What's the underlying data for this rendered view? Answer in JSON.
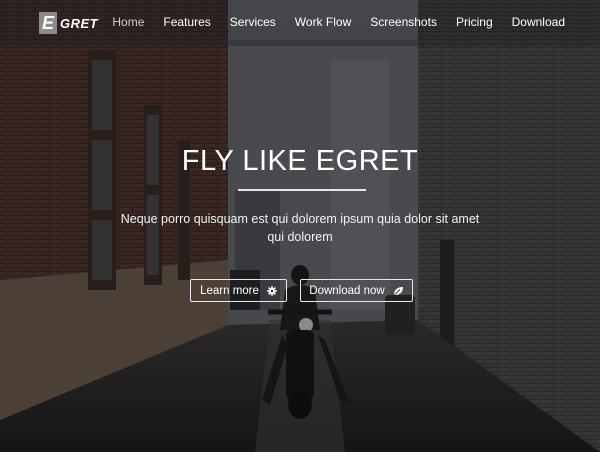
{
  "logo": {
    "letter": "E",
    "rest": "GRET"
  },
  "nav": {
    "items": [
      {
        "label": "Home",
        "active": true
      },
      {
        "label": "Features"
      },
      {
        "label": "Services"
      },
      {
        "label": "Work Flow"
      },
      {
        "label": "Screenshots"
      },
      {
        "label": "Pricing"
      },
      {
        "label": "Download"
      }
    ]
  },
  "hero": {
    "title": "FLY LIKE EGRET",
    "subtitle": "Neque porro quisquam est qui dolorem ipsum quia dolor sit amet qui dolorem",
    "buttons": {
      "learn_more": {
        "label": "Learn more",
        "icon": "gear-icon"
      },
      "download_now": {
        "label": "Download now",
        "icon": "leaf-icon"
      }
    }
  }
}
